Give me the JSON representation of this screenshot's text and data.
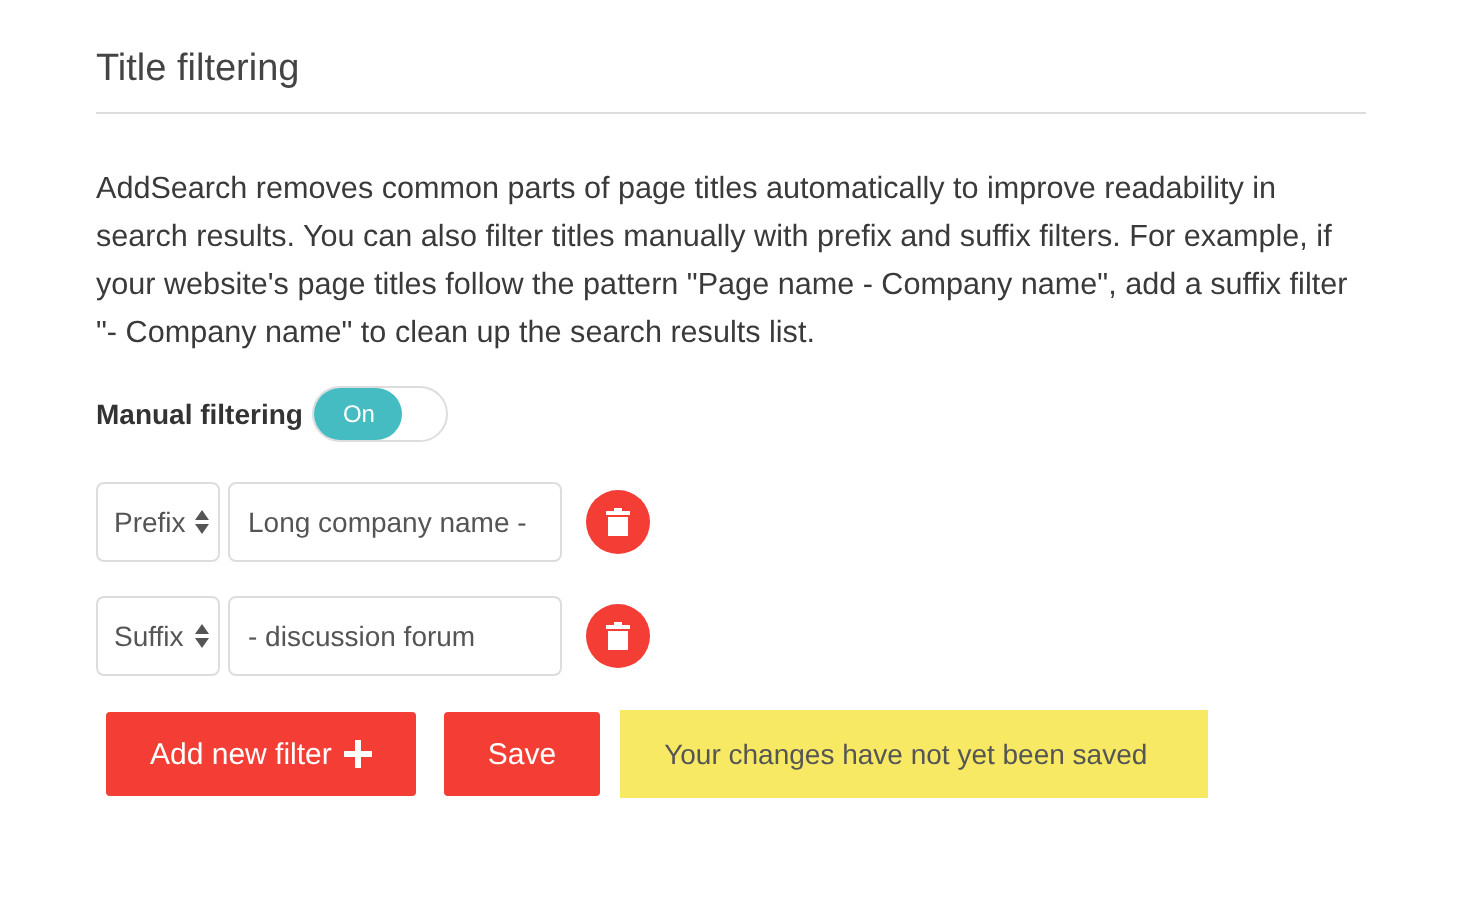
{
  "section": {
    "title": "Title filtering"
  },
  "description": "AddSearch removes common parts of page titles automatically to improve readability in search results. You can also filter titles manually with prefix and suffix filters. For example, if your website's page titles follow the pattern \"Page name - Company name\", add a suffix filter \"- Company name\" to clean up the search results list.",
  "manual_filtering": {
    "label": "Manual filtering",
    "on": true,
    "state_label": "On"
  },
  "filters": [
    {
      "type": "Prefix",
      "value": "Long company name -"
    },
    {
      "type": "Suffix",
      "value": "- discussion forum"
    }
  ],
  "buttons": {
    "add": "Add new filter",
    "save": "Save"
  },
  "notice": "Your changes have not yet been saved"
}
